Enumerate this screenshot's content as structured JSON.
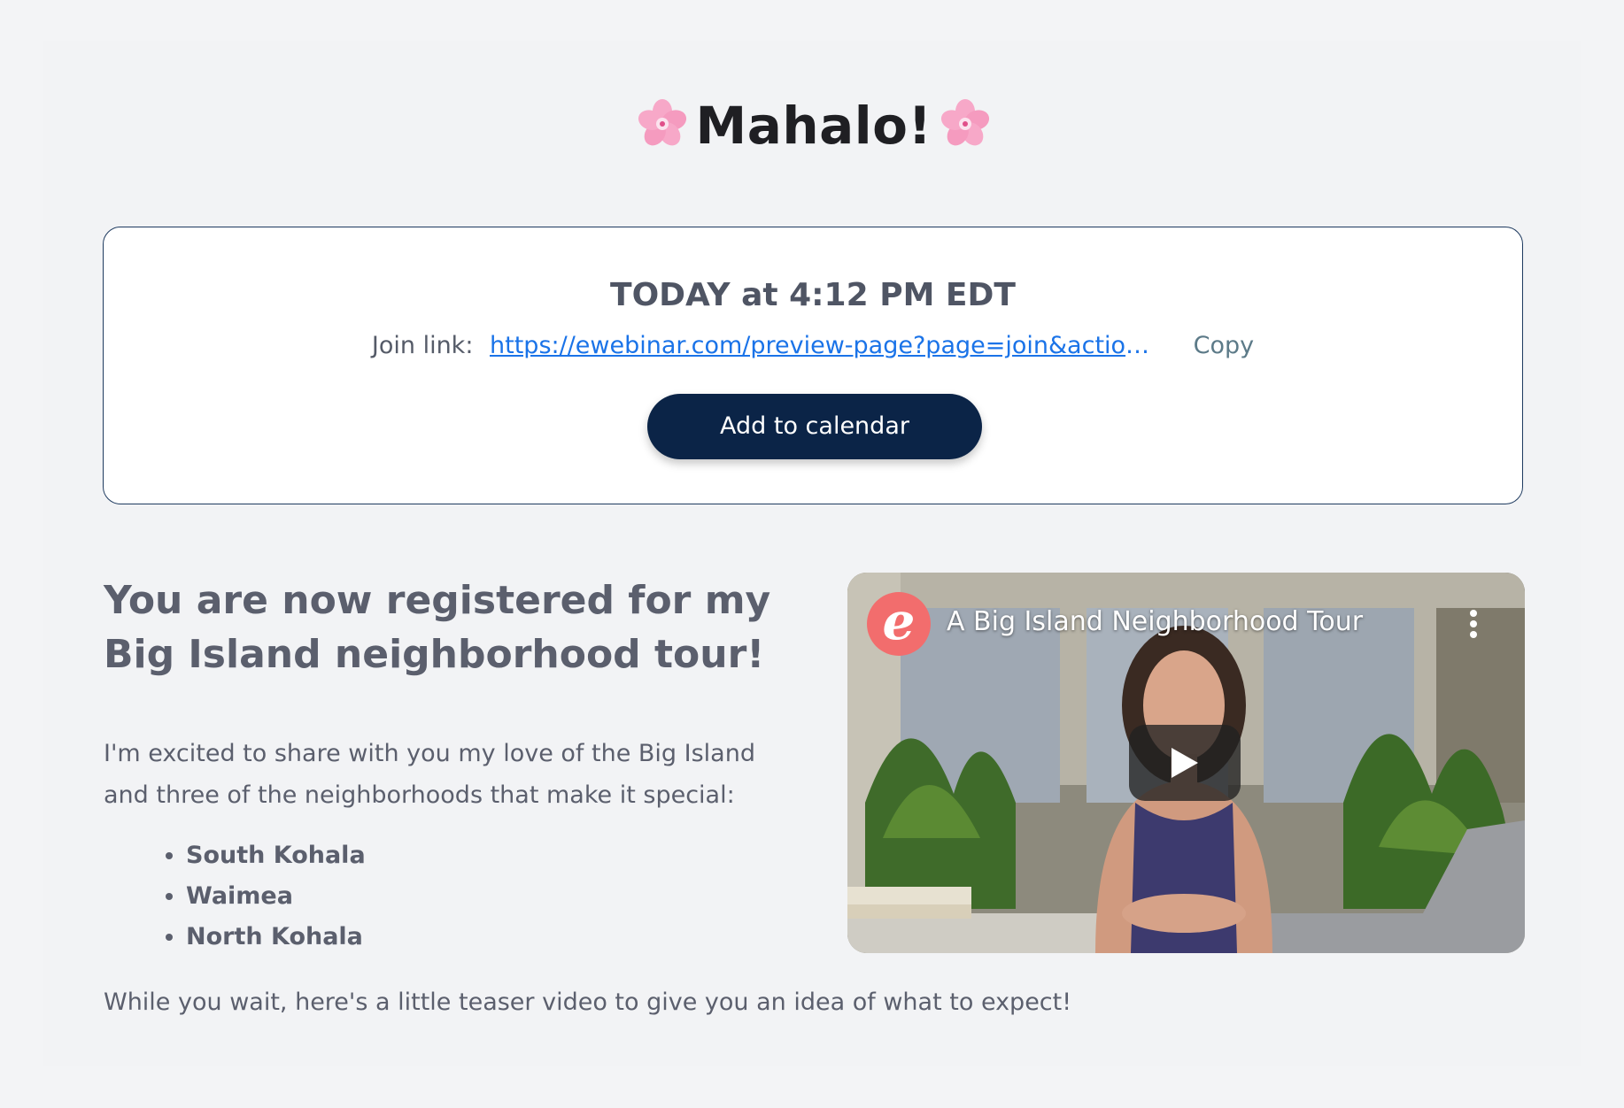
{
  "page": {
    "title": "Mahalo!",
    "title_icon": "cherry-blossom-icon"
  },
  "registration_card": {
    "date_text": "TODAY at 4:12 PM EDT",
    "join_label": "Join link:",
    "join_url": "https://ewebinar.com/preview-page?page=join&action=w…",
    "copy_label": "Copy",
    "calendar_button_label": "Add to calendar"
  },
  "content": {
    "headline": "You are now registered for my Big Island neighborhood tour!",
    "intro": "I'm excited to share with you my love of the Big Island and three of the neighborhoods that make it special:",
    "neighborhoods": [
      "South Kohala",
      "Waimea",
      "North Kohala"
    ],
    "outro": "While you wait, here's a little teaser video to give you an idea of what to expect!"
  },
  "video": {
    "channel_logo_letter": "e",
    "title": "A Big Island Neighborhood Tour",
    "play_icon": "play-icon",
    "menu_icon": "more-vertical-icon"
  },
  "colors": {
    "background": "#f3f4f6",
    "button_navy": "#0b2447",
    "link_blue": "#1a73e8",
    "logo_coral": "#f26d6d"
  }
}
